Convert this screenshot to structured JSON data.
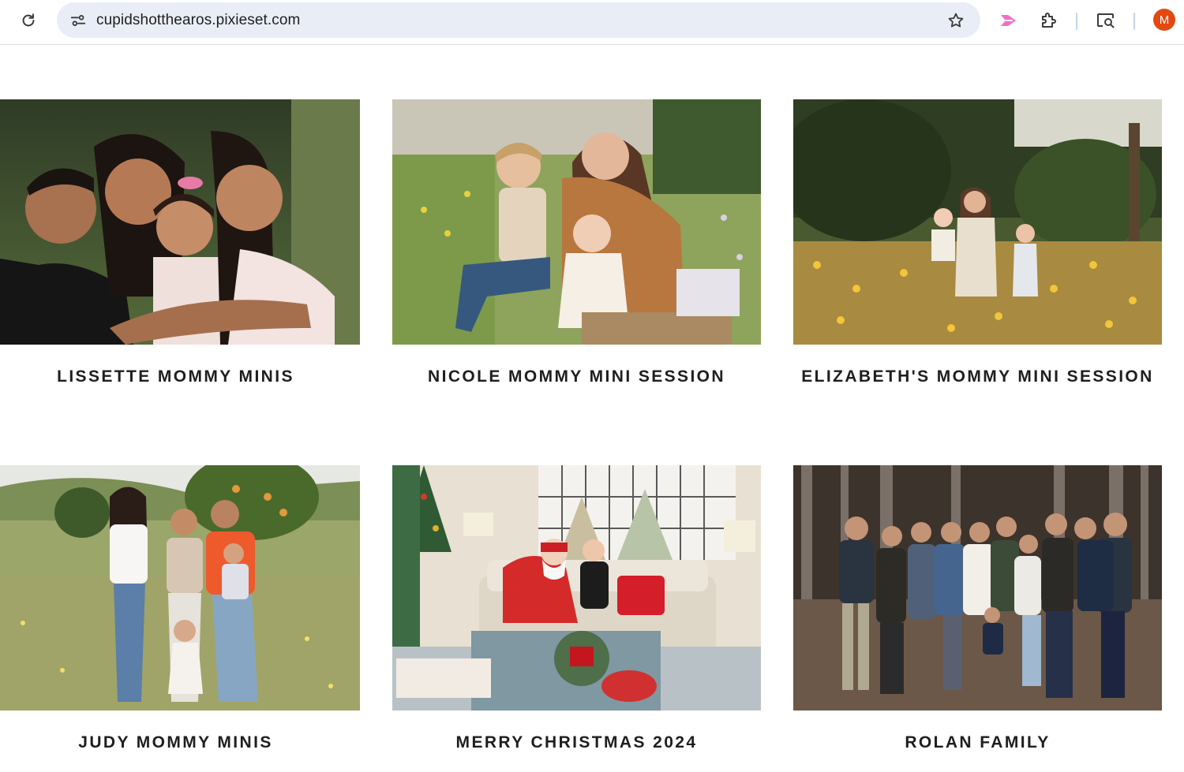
{
  "browser": {
    "url": "cupidshotthearos.pixieset.com",
    "profile_initial": "M",
    "icons": [
      "reload-icon",
      "site-info-icon",
      "bookmark-star-icon",
      "extension-pink-icon",
      "extensions-puzzle-icon",
      "cast-search-icon"
    ],
    "accent_profile": "#e2480f"
  },
  "gallery": {
    "collections": [
      {
        "title": "LISSETTE MOMMY MINIS"
      },
      {
        "title": "NICOLE MOMMY MINI SESSION"
      },
      {
        "title": "ELIZABETH'S MOMMY MINI SESSION"
      },
      {
        "title": "JUDY MOMMY MINIS"
      },
      {
        "title": "MERRY CHRISTMAS 2024"
      },
      {
        "title": "ROLAN FAMILY"
      }
    ]
  }
}
